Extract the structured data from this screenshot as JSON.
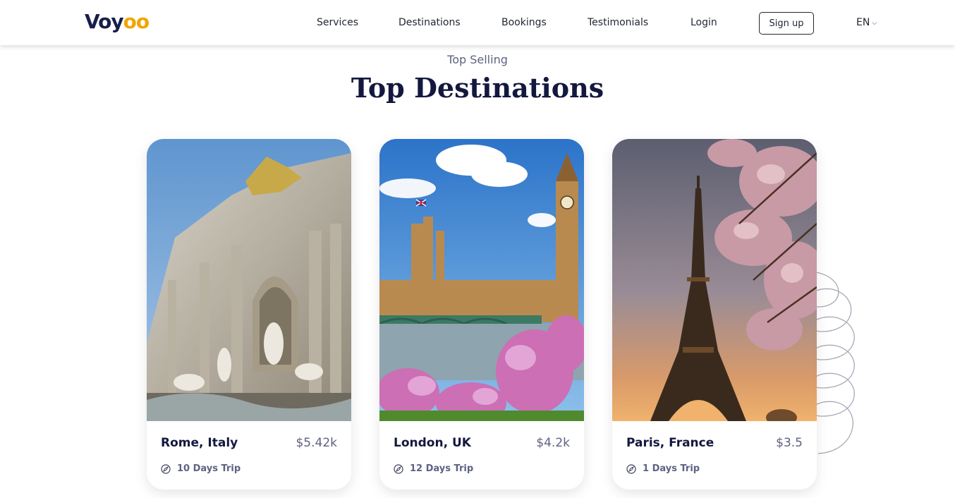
{
  "header": {
    "logo_text": "Voy",
    "logo_accent": "oo",
    "nav": [
      "Services",
      "Destinations",
      "Bookings",
      "Testimonials",
      "Login"
    ],
    "signup_label": "Sign up",
    "language": "EN"
  },
  "section": {
    "subtitle": "Top Selling",
    "title": "Top Destinations"
  },
  "cards": [
    {
      "name": "Rome, Italy",
      "price": "$5.42k",
      "trip": "10 Days Trip"
    },
    {
      "name": "London, UK",
      "price": "$4.2k",
      "trip": "12 Days Trip"
    },
    {
      "name": "Paris, France",
      "price": "$3.5",
      "trip": "1 Days Trip"
    }
  ],
  "colors": {
    "brand_dark": "#181E4B",
    "brand_accent": "#F1A501",
    "muted_text": "#5E6282"
  },
  "icons": {
    "extension_1": "fire-lock-icon",
    "extension_2": "shield-check-icon",
    "trip": "navigation-compass-icon"
  }
}
